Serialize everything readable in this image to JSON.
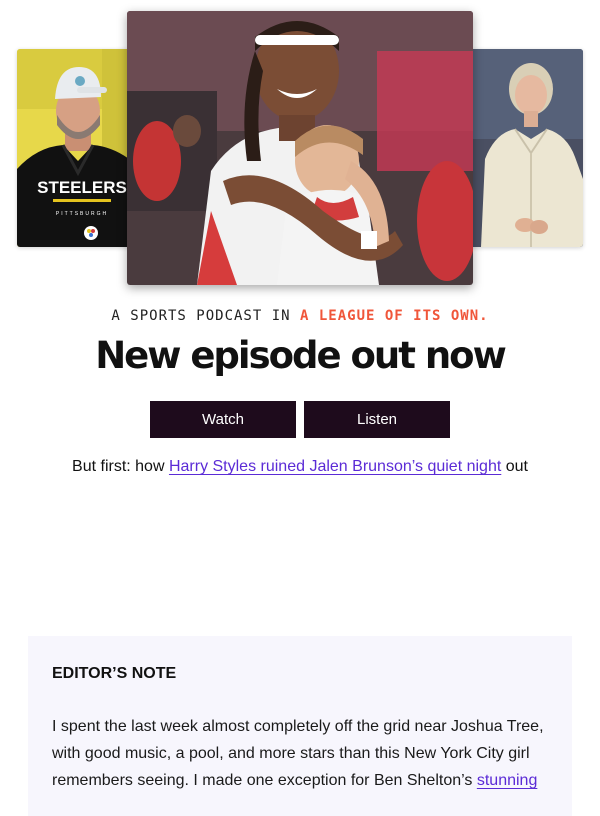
{
  "hero": {
    "left_photo": {
      "shirt_text": "STEELERS",
      "shirt_subtext": "PITTSBURGH"
    },
    "center_photo": {},
    "right_photo": {}
  },
  "promo": {
    "tagline_prefix": "A SPORTS PODCAST IN ",
    "tagline_accent": "A LEAGUE OF ITS OWN.",
    "headline": "New episode out now",
    "watch_label": "Watch",
    "listen_label": "Listen"
  },
  "teaser": {
    "prefix": "But first: how ",
    "link_text": "Harry Styles ruined Jalen Brunson’s quiet night",
    "suffix": " out"
  },
  "editors_note": {
    "title": "EDITOR’S NOTE",
    "body_text": "I spent the last week almost completely off the grid near Joshua Tree, with good music, a pool, and more stars than this New York City girl remembers seeing. I made one exception for Ben Shelton’s ",
    "link_text": "stunning"
  },
  "colors": {
    "accent": "#f0563a",
    "button_bg": "#1e0b1c",
    "link": "#5b2bd6",
    "note_bg": "#f7f6fd"
  }
}
